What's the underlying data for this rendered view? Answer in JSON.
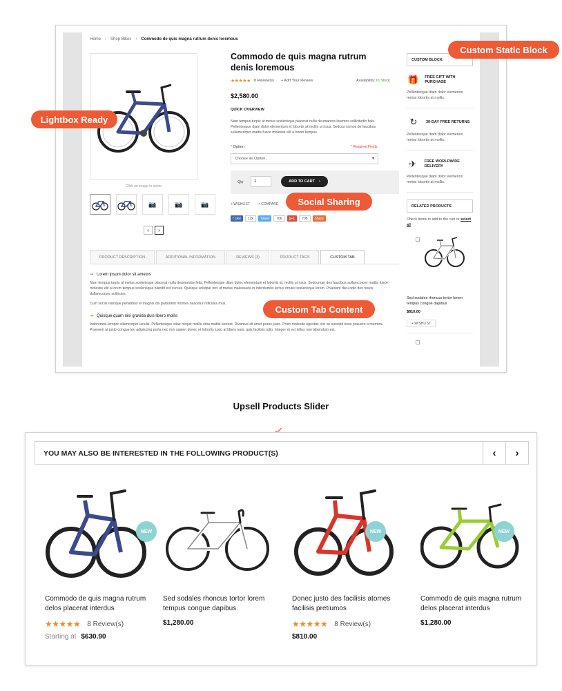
{
  "breadcrumb": {
    "home": "Home",
    "category": "Shop Bikes",
    "current": "Commodo de quis magna rutrum denis loremous",
    "sep": "›"
  },
  "product": {
    "title": "Commodo de quis magna rutrum denis loremous",
    "stars": "★★★★★",
    "reviews": "8 Review(s)",
    "add_review": "+ Add Your Review",
    "availability_label": "Availability:",
    "availability_value": "In Stock",
    "price": "$2,580.00",
    "quick_overview_title": "QUICK OVERVIEW",
    "quick_overview_text": "Nam tempus turpis at metus scelerisque placerat nulla deumantos loremos sollicitudin felis. Pellentesque diam dolor elementum et lobortis at mollis ut risus. Sedcus comos de faucibus sullamcorper mattis fusce molestie elit a lorem tempus.",
    "option_label": "Option",
    "option_required": "*",
    "required_fields": "* Required Fields",
    "option_placeholder": "Choose an Option...",
    "qty_label": "Qty",
    "qty_value": "1",
    "add_to_cart": "ADD TO CART",
    "wishlist": "+ WISHLIST",
    "compare": "+ COMPARE",
    "zoom_hint": "Click on image to zoom"
  },
  "social": {
    "fb": "f Like",
    "fb_count": "12k",
    "tw": "Tweet",
    "tw_count": "706",
    "gp": "g+1",
    "gp_count": "705",
    "share": "Share"
  },
  "tabs": [
    {
      "label": "PRODUCT DESCRIPTION"
    },
    {
      "label": "ADDITIONAL INFORMATION"
    },
    {
      "label": "REVIEWS (3)"
    },
    {
      "label": "PRODUCT TAGS"
    },
    {
      "label": "CUSTOM TAB"
    }
  ],
  "tab_content": {
    "heading1": "Lorem ipsum dolor sit ametos",
    "text1": "Nam tempus turpis at metus scelerisque placerat nulla deumantos felis. Pellentesque diam dolor, elementum et lobortis at, mollis ut risus. Sedcuman des faucibus sullamcorper mattis fusce molestie elit a lorem tempus scelerisque blandit est cursus. Quisque volutpat orci ut metus malesuada in interdumos lectus ornare scelerisque lorem. Praesent dieu odio des nisios dullamcorper sultricies.",
    "text2": "Cum sociis natoque penatibus et magnis dis parturient montes nascetur ridiculus mus.",
    "heading2": "Quisque quam nisi gravida duis libero mollis",
    "text3": "Indoremos tempor ullamcorper iaculis. Pellentesque vitae neque mollis urna mattis laoreet. Divamus sit amet purus justo. Proin molestie egestas orci ac suscipit risus posuere a memtos. Praesent at justo congue leo adipiscing porta nec non sapien donec et lobortis justo at libero nunc quis facilisis odio. Integer et est tellus non bibendum est."
  },
  "sidebar": {
    "custom_block_title": "CUSTOM BLOCK",
    "features": [
      {
        "icon": "gift-icon",
        "title": "FREE GIFT WITH PURCHASE",
        "text": "Pellentesque diam dolor elemenos metos lobortis at mollis."
      },
      {
        "icon": "return-icon",
        "title": "30-DAY FREE RETURNS",
        "text": "Pellentesque diam dolor elemenos metos lobortis at mollis."
      },
      {
        "icon": "plane-icon",
        "title": "FREE WORLDWIDE DELIVERY",
        "text": "Pellentesque diam dolor elemenos metos lobortis at mollis."
      }
    ],
    "related_title": "RELATED PRODUCTS",
    "related_check_text": "Check items to add to the cart or",
    "select_all": "select all",
    "related_name": "Sed sodales rhoncus tortor lorem tempus congue dapibus",
    "related_price": "$810.00",
    "related_wishlist": "+ WISHLIST"
  },
  "callouts": {
    "lightbox": "Lightbox Ready",
    "static_block": "Custom Static Block",
    "social_sharing": "Social Sharing",
    "custom_tab": "Custom Tab Content"
  },
  "upsell": {
    "caption": "Upsell Products Slider",
    "title": "YOU MAY ALSO BE INTERESTED IN THE FOLLOWING PRODUCT(S)",
    "prev": "‹",
    "next": "›",
    "badge": "NEW",
    "products": [
      {
        "name": "Commodo de quis magna rutrum delos placerat interdus",
        "stars": "★★★★★",
        "reviews": "8 Review(s)",
        "price_label": "Starting at",
        "price": "$630.90",
        "color": "#3b4a8a"
      },
      {
        "name": "Sed sodales rhoncus tortor lorem tempus congue dapibus",
        "price": "$1,280.00",
        "color": "#d8d8d8"
      },
      {
        "name": "Donec justo des facilisis atomes facilisis pretiumos",
        "stars": "★★★★★",
        "reviews": "8 Review(s)",
        "price": "$810.00",
        "color": "#d8342b"
      },
      {
        "name": "Commodo de quis magna rutrum delos placerat interdus",
        "price": "$1,280.00",
        "color": "#9acd32"
      }
    ]
  }
}
